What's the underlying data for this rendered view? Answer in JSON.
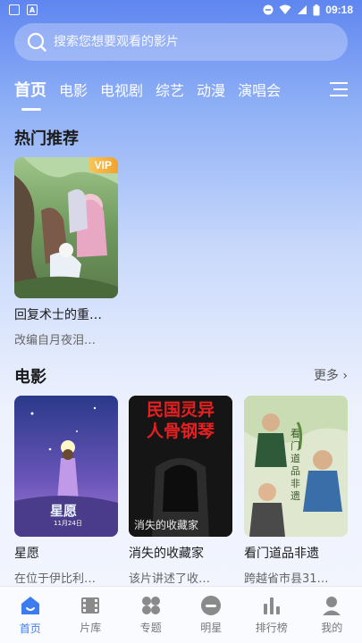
{
  "status": {
    "time": "09:18"
  },
  "search": {
    "placeholder": "搜索您想要观看的影片"
  },
  "tabs": [
    {
      "label": "首页",
      "active": true
    },
    {
      "label": "电影"
    },
    {
      "label": "电视剧"
    },
    {
      "label": "综艺"
    },
    {
      "label": "动漫"
    },
    {
      "label": "演唱会"
    }
  ],
  "hot": {
    "title": "热门推荐",
    "items": [
      {
        "title": "回复术士的重…",
        "desc": "改编自月夜泪…",
        "badge": "VIP"
      }
    ]
  },
  "movies": {
    "title": "电影",
    "more": "更多 ›",
    "items": [
      {
        "title": "星愿",
        "desc": "在位于伊比利…",
        "poster_text": "星愿",
        "poster_sub": "11月24日"
      },
      {
        "title": "消失的收藏家",
        "desc": "该片讲述了收…",
        "poster_text": "民国灵异\n人骨钢琴",
        "poster_sub": "消失的收藏家"
      },
      {
        "title": "看门道品非遗",
        "desc": "跨越省市县31…",
        "poster_text": "看门道品非遗"
      }
    ]
  },
  "nav": [
    {
      "label": "首页",
      "icon": "home-icon",
      "active": true
    },
    {
      "label": "片库",
      "icon": "film-icon"
    },
    {
      "label": "专题",
      "icon": "grid-icon"
    },
    {
      "label": "明星",
      "icon": "star-person-icon"
    },
    {
      "label": "排行榜",
      "icon": "chart-icon"
    },
    {
      "label": "我的",
      "icon": "user-icon"
    }
  ],
  "colors": {
    "accent": "#3c7cf0",
    "vip": "#f3b23d"
  }
}
